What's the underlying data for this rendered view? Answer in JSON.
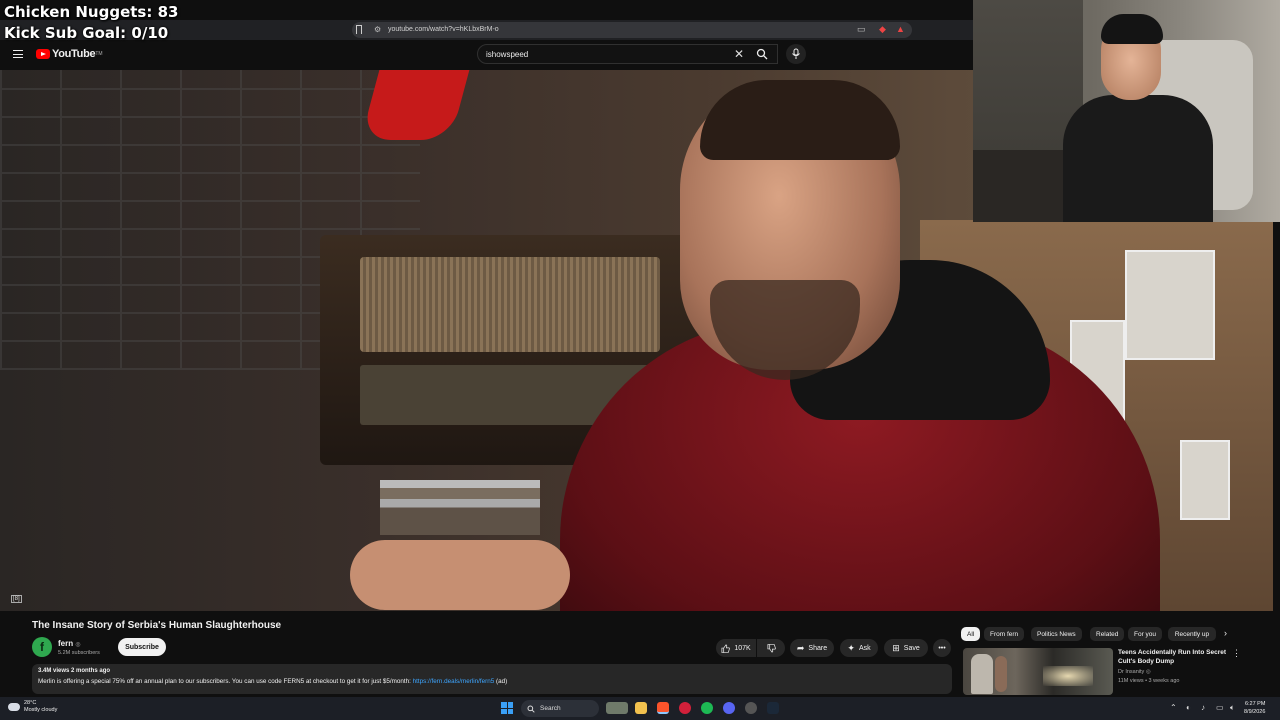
{
  "overlay": {
    "line1": "Chicken Nuggets: 83",
    "line2": "Kick Sub Goal: 0/10"
  },
  "browser": {
    "url": "youtube.com/watch?v=hKLbxBrM-o"
  },
  "youtube": {
    "logo_text": "YouTube",
    "logo_tm": "TM",
    "search_value": "ishowspeed"
  },
  "video": {
    "cc_badge": "[8]"
  },
  "details": {
    "title": "The Insane Story of Serbia's Human Slaughterhouse",
    "channel_initial": "f",
    "channel_name": "fern",
    "channel_verified": "◎",
    "subscribers": "5.2M subscribers",
    "subscribe_label": "Subscribe",
    "likes": "107K",
    "share_label": "Share",
    "ask_label": "Ask",
    "save_label": "Save",
    "views_date": "3.4M views  2 months ago",
    "description_text": "Merlin is offering a special 75% off an annual plan to our subscribers. You can use code FERN5 at checkout to get it for just $5/month: ",
    "description_link": "https://fern.deals/merlin/fern5",
    "description_suffix": " (ad)"
  },
  "chips": [
    "All",
    "From fern",
    "Politics News",
    "Related",
    "For you",
    "Recently up"
  ],
  "recommendation": {
    "title": "Teens Accidentally Run Into Secret Cult's Body Dump",
    "channel": "Dr Insanity ◎",
    "meta": "11M views • 3 weeks ago"
  },
  "taskbar": {
    "weather_temp": "28°C",
    "weather_desc": "Mostly cloudy",
    "search_label": "Search",
    "time": "6:27 PM",
    "date": "8/9/2026"
  },
  "colors": {
    "accent_red": "#ff0000",
    "link_blue": "#3ea6ff",
    "channel_green": "#2fa84f",
    "windows_blue": "#3a9ff5"
  }
}
